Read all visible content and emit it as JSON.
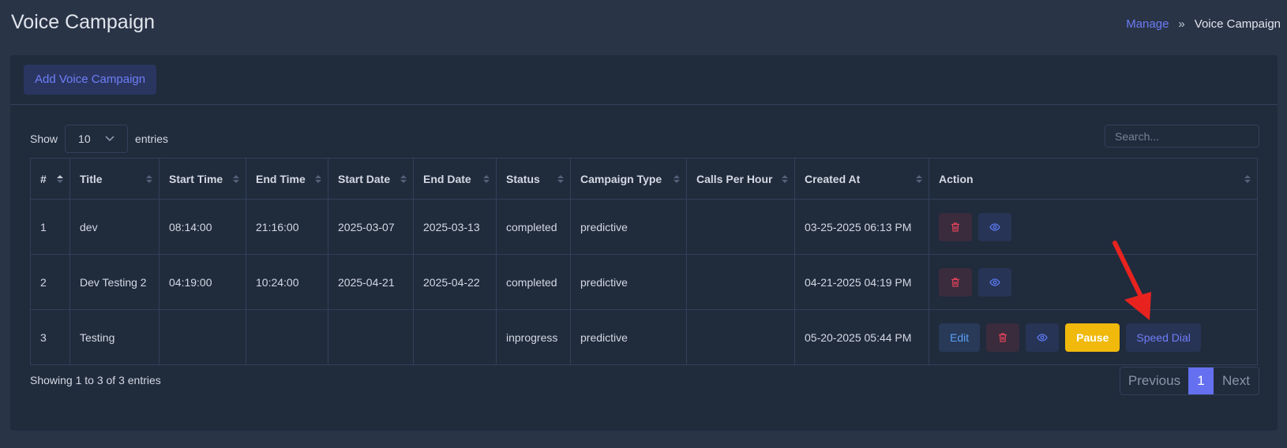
{
  "header": {
    "title": "Voice Campaign",
    "breadcrumb": {
      "link": "Manage",
      "separator": "»",
      "current": "Voice Campaign"
    }
  },
  "toolbar": {
    "add_label": "Add Voice Campaign"
  },
  "controls": {
    "show_label": "Show",
    "page_size": "10",
    "entries_label": "entries",
    "search_placeholder": "Search..."
  },
  "table": {
    "columns": [
      "#",
      "Title",
      "Start Time",
      "End Time",
      "Start Date",
      "End Date",
      "Status",
      "Campaign Type",
      "Calls Per Hour",
      "Created At",
      "Action"
    ],
    "rows": [
      {
        "num": "1",
        "title": "dev",
        "start_time": "08:14:00",
        "end_time": "21:16:00",
        "start_date": "2025-03-07",
        "end_date": "2025-03-13",
        "status": "completed",
        "type": "predictive",
        "cph": "",
        "created": "03-25-2025 06:13 PM"
      },
      {
        "num": "2",
        "title": "Dev Testing 2",
        "start_time": "04:19:00",
        "end_time": "10:24:00",
        "start_date": "2025-04-21",
        "end_date": "2025-04-22",
        "status": "completed",
        "type": "predictive",
        "cph": "",
        "created": "04-21-2025 04:19 PM"
      },
      {
        "num": "3",
        "title": "Testing",
        "start_time": "",
        "end_time": "",
        "start_date": "",
        "end_date": "",
        "status": "inprogress",
        "type": "predictive",
        "cph": "",
        "created": "05-20-2025 05:44 PM"
      }
    ],
    "actions": {
      "edit": "Edit",
      "pause": "Pause",
      "speed_dial": "Speed Dial"
    }
  },
  "footer": {
    "info": "Showing 1 to 3 of 3 entries",
    "pagination": {
      "previous": "Previous",
      "current": "1",
      "next": "Next"
    }
  },
  "colors": {
    "accent": "#6470f0",
    "danger": "#e0435a",
    "warning": "#f0b90b",
    "annotation_arrow": "#e8231f"
  }
}
